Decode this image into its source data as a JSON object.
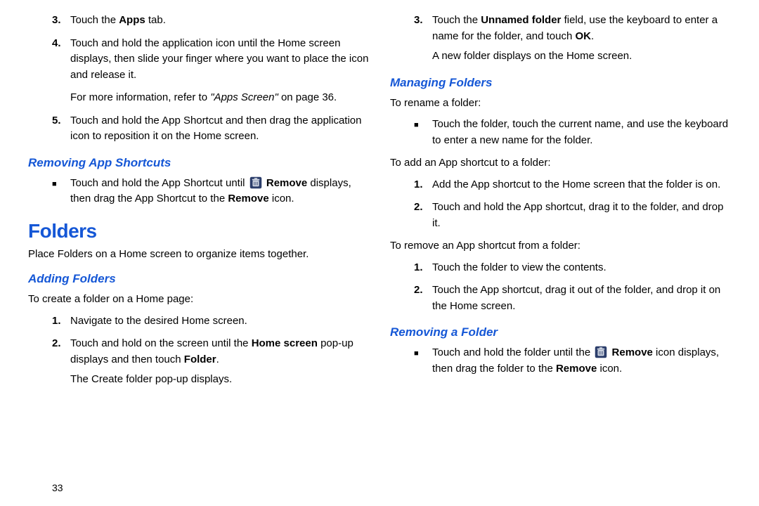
{
  "left": {
    "steps_a": {
      "s3": {
        "num": "3.",
        "t1": "Touch the ",
        "b1": "Apps",
        "t2": " tab."
      },
      "s4": {
        "num": "4.",
        "t1": "Touch and hold the application icon until the Home screen displays, then slide your finger where you want to place the icon and release it."
      },
      "s4_more_a": "For more information, refer to ",
      "s4_more_i": "\"Apps Screen\"",
      "s4_more_b": " on page 36.",
      "s5": {
        "num": "5.",
        "t1": "Touch and hold the App Shortcut and then drag the application icon to reposition it on the Home screen."
      }
    },
    "h_remove_short": "Removing App Shortcuts",
    "remove_short": {
      "t1": "Touch and hold the App Shortcut until ",
      "b1": "Remove",
      "t2": " displays, then drag the App Shortcut to the ",
      "b2": "Remove",
      "t3": " icon."
    },
    "h_folders": "Folders",
    "folders_intro": "Place Folders on a Home screen to organize items together.",
    "h_adding": "Adding Folders",
    "adding_lead": "To create a folder on a Home page:",
    "adding": {
      "s1": {
        "num": "1.",
        "t1": "Navigate to the desired Home screen."
      },
      "s2": {
        "num": "2.",
        "t1": "Touch and hold on the screen until the ",
        "b1": "Home screen",
        "t2": " pop-up displays and then touch ",
        "b2": "Folder",
        "t3": "."
      },
      "s2_after": "The Create folder pop-up displays."
    },
    "page": "33"
  },
  "right": {
    "steps": {
      "s3": {
        "num": "3.",
        "t1": "Touch the ",
        "b1": "Unnamed folder",
        "t2": " field, use the keyboard to enter a name for the folder, and touch ",
        "b2": "OK",
        "t3": "."
      },
      "s3_after": "A new folder displays on the Home screen."
    },
    "h_managing": "Managing Folders",
    "rename_lead": "To rename a folder:",
    "rename_b": "Touch the folder, touch the current name, and use the keyboard to enter a new name for the folder.",
    "addshort_lead": "To add an App shortcut to a folder:",
    "addshort": {
      "s1": {
        "num": "1.",
        "t1": "Add the App shortcut to the Home screen that the folder is on."
      },
      "s2": {
        "num": "2.",
        "t1": "Touch and hold the App shortcut, drag it to the folder, and drop it."
      }
    },
    "removeshort_lead": "To remove an App shortcut from a folder:",
    "removeshort": {
      "s1": {
        "num": "1.",
        "t1": "Touch the folder to view the contents."
      },
      "s2": {
        "num": "2.",
        "t1": "Touch the App shortcut, drag it out of the folder, and drop it on the Home screen."
      }
    },
    "h_removefolder": "Removing a Folder",
    "removefolder": {
      "t1": "Touch and hold the folder until the ",
      "b1": "Remove",
      "t2": " icon displays, then drag the folder to the ",
      "b2": "Remove",
      "t3": " icon."
    }
  }
}
